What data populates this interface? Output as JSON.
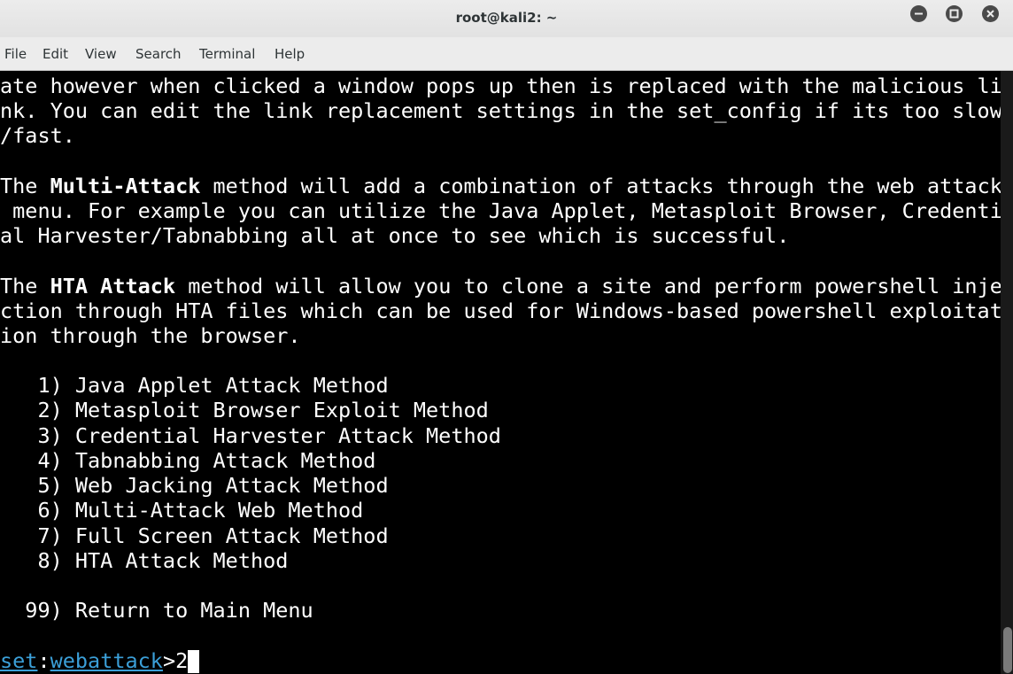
{
  "window": {
    "title": "root@kali2: ~"
  },
  "menubar": {
    "items": [
      "File",
      "Edit",
      "View",
      "Search",
      "Terminal",
      "Help"
    ]
  },
  "terminal": {
    "para1": {
      "line1": "ate however when clicked a window pops up then is replaced with the malicious li",
      "line2": "nk. You can edit the link replacement settings in the set_config if its too slow",
      "line3": "/fast."
    },
    "para2": {
      "pre": "The ",
      "bold": "Multi-Attack",
      "post": " method will add a combination of attacks through the web attack",
      "line2": " menu. For example you can utilize the Java Applet, Metasploit Browser, Credenti",
      "line3": "al Harvester/Tabnabbing all at once to see which is successful."
    },
    "para3": {
      "pre": "The ",
      "bold": "HTA Attack",
      "post": " method will allow you to clone a site and perform powershell inje",
      "line2": "ction through HTA files which can be used for Windows-based powershell exploitat",
      "line3": "ion through the browser."
    },
    "options": [
      "   1) Java Applet Attack Method",
      "   2) Metasploit Browser Exploit Method",
      "   3) Credential Harvester Attack Method",
      "   4) Tabnabbing Attack Method",
      "   5) Web Jacking Attack Method",
      "   6) Multi-Attack Web Method",
      "   7) Full Screen Attack Method",
      "   8) HTA Attack Method"
    ],
    "return_option": "  99) Return to Main Menu",
    "prompt": {
      "set": "set",
      "sep": ":",
      "module": "webattack",
      "gt": ">",
      "input": "2"
    }
  },
  "colors": {
    "background": "#000000",
    "text": "#ffffff",
    "prompt_link": "#3b9fd8",
    "titlebar": "#e6e6e6"
  }
}
